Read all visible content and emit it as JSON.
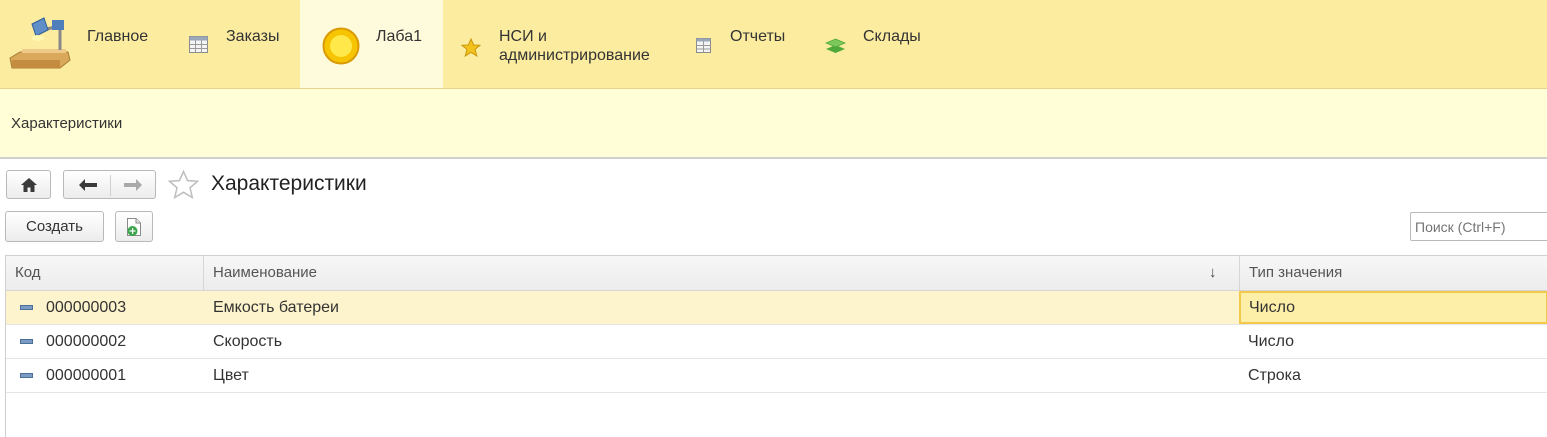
{
  "sections": [
    {
      "id": "main",
      "label": "Главное",
      "icon": "desk-lamp-icon"
    },
    {
      "id": "orders",
      "label": "Заказы",
      "icon": "table-grid-icon"
    },
    {
      "id": "lab1",
      "label": "Лаба1",
      "icon": "yellow-circle-icon",
      "active": true
    },
    {
      "id": "nsi",
      "label_line1": "НСИ и",
      "label_line2": "администрирование",
      "icon": "star-icon"
    },
    {
      "id": "reports",
      "label": "Отчеты",
      "icon": "report-table-icon"
    },
    {
      "id": "warehouses",
      "label": "Склады",
      "icon": "green-layers-icon"
    }
  ],
  "subpanel": {
    "link": "Характеристики"
  },
  "form": {
    "title": "Характеристики",
    "create_label": "Создать",
    "search_placeholder": "Поиск (Ctrl+F)"
  },
  "table": {
    "columns": [
      "Код",
      "Наименование",
      "Тип значения"
    ],
    "sort_indicator": "↓",
    "rows": [
      {
        "code": "000000003",
        "name": "Емкость батереи",
        "type": "Число",
        "selected": true
      },
      {
        "code": "000000002",
        "name": "Скорость",
        "type": "Число"
      },
      {
        "code": "000000001",
        "name": "Цвет",
        "type": "Строка"
      }
    ]
  },
  "colors": {
    "topbar": "#fbeca0",
    "active_section": "#fefbdc",
    "subpanel": "#fffed6",
    "selected_row": "#fdf3cc",
    "focus_border": "#f2c94c"
  }
}
